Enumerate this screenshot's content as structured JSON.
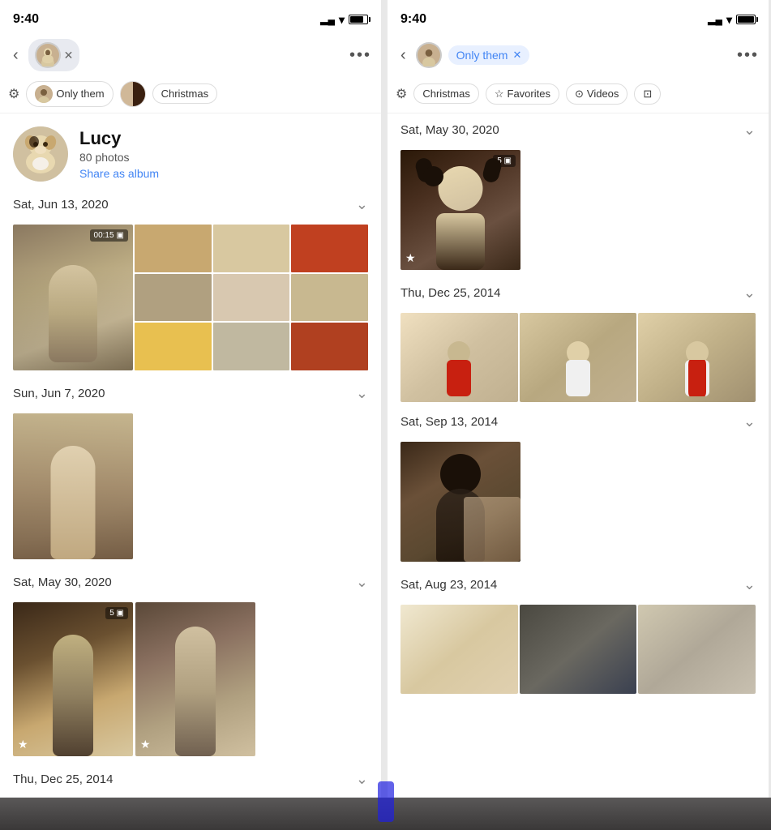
{
  "left_screen": {
    "status": {
      "time": "9:40",
      "battery_pct": 70
    },
    "nav": {
      "back_label": "<",
      "more_label": "···"
    },
    "filter_bar": {
      "filter_icon": "≡",
      "chips": [
        {
          "label": "Only them",
          "has_avatar": true,
          "active": false
        },
        {
          "label": "",
          "is_thumbnails": true
        },
        {
          "label": "Christmas",
          "active": false
        }
      ]
    },
    "profile": {
      "name": "Lucy",
      "photo_count": "80 photos",
      "share_label": "Share as album"
    },
    "sections": [
      {
        "date": "Sat, Jun 13, 2020",
        "collapsed": false,
        "photos": [
          "video_large",
          "grid_9"
        ]
      },
      {
        "date": "Sun, Jun 7, 2020",
        "collapsed": false,
        "photos": [
          "single_large"
        ]
      },
      {
        "date": "Sat, May 30, 2020",
        "collapsed": false,
        "photos": [
          "two_tall"
        ]
      },
      {
        "date": "Thu, Dec 25, 2014",
        "collapsed": false,
        "partial": true
      }
    ]
  },
  "right_screen": {
    "status": {
      "time": "9:40",
      "battery_pct": 90
    },
    "nav": {
      "back_label": "<",
      "person_chip_label": "Only them",
      "close_label": "✕",
      "more_label": "···"
    },
    "filter_bar": {
      "filter_icon": "≡",
      "chips": [
        {
          "label": "Christmas",
          "active": false
        },
        {
          "label": "Favorites",
          "has_star": true,
          "active": false
        },
        {
          "label": "Videos",
          "has_play": true,
          "active": false
        },
        {
          "label": "",
          "has_person": true,
          "active": false
        }
      ]
    },
    "sections": [
      {
        "date": "Sat, May 30, 2020",
        "collapsed": false,
        "photos": [
          "single_dark_star"
        ]
      },
      {
        "date": "Thu, Dec 25, 2014",
        "collapsed": false,
        "photos": [
          "triple_red"
        ]
      },
      {
        "date": "Sat, Sep 13, 2014",
        "collapsed": false,
        "photos": [
          "single_dark2"
        ]
      },
      {
        "date": "Sat, Aug 23, 2014",
        "collapsed": false,
        "photos": [
          "triple_aug"
        ]
      }
    ]
  }
}
